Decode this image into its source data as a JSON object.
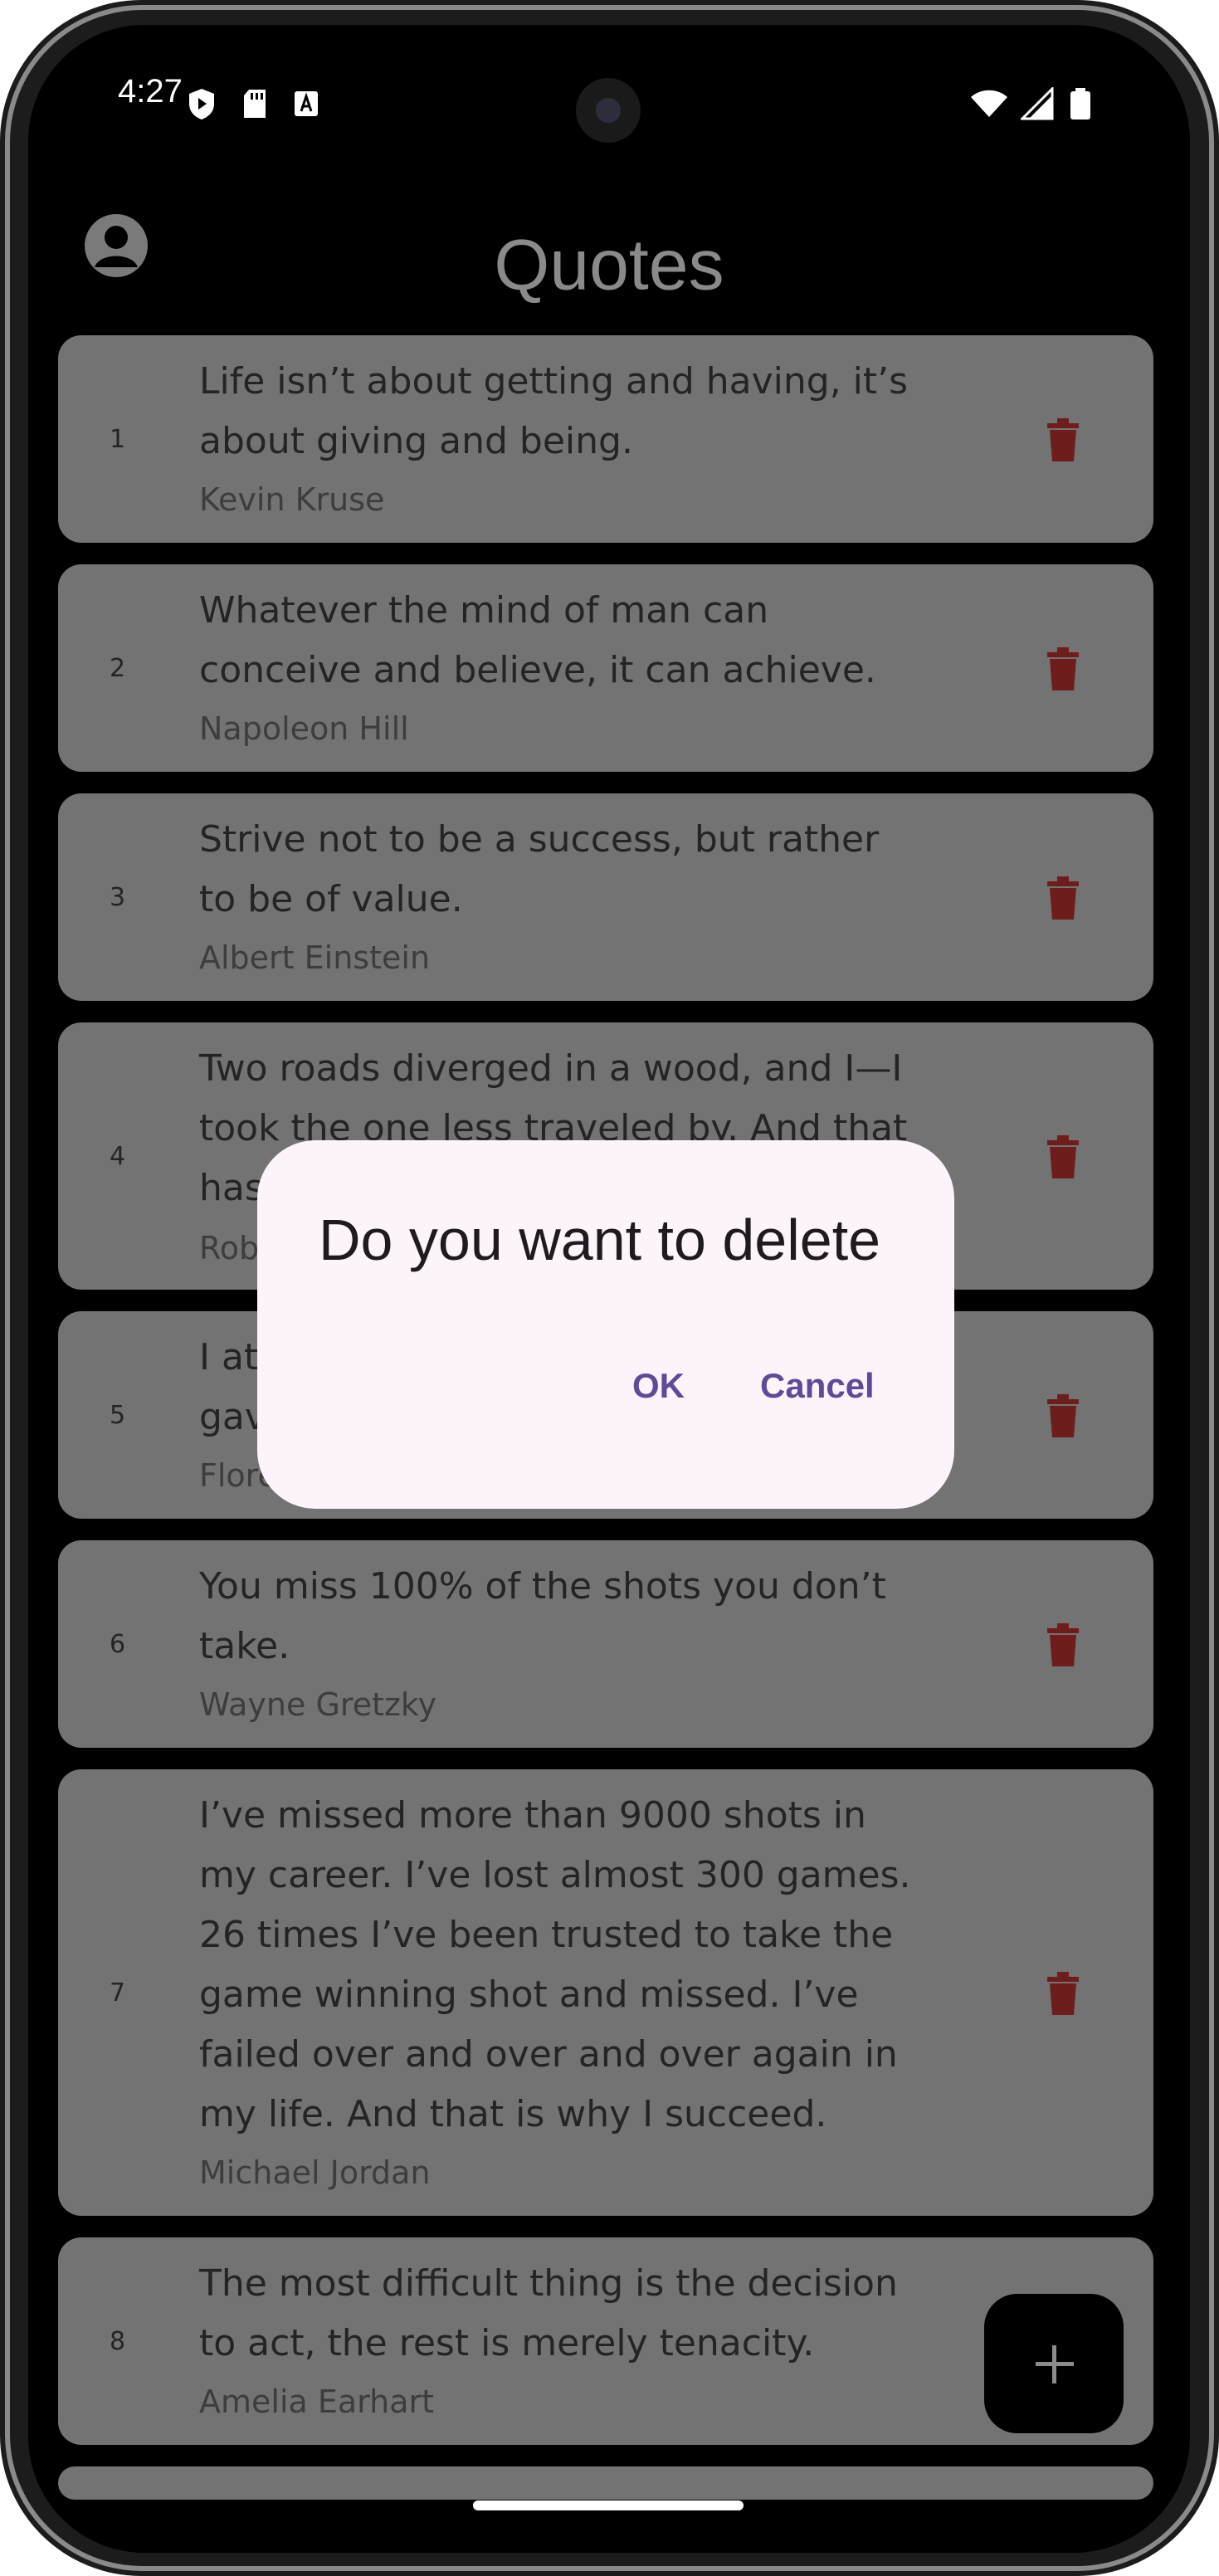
{
  "status_bar": {
    "time": "4:27"
  },
  "header": {
    "title": "Quotes"
  },
  "quotes": [
    {
      "num": "1",
      "lines": [
        "Life isn’t about getting and having, it’s",
        "about giving and being."
      ],
      "author": "Kevin Kruse"
    },
    {
      "num": "2",
      "lines": [
        "Whatever the mind of man can",
        "conceive and believe, it can achieve."
      ],
      "author": "Napoleon Hill"
    },
    {
      "num": "3",
      "lines": [
        "Strive not to be a success, but rather",
        "to be of value."
      ],
      "author": "Albert Einstein"
    },
    {
      "num": "4",
      "lines": [
        "Two roads diverged in a wood, and I—I",
        "took the one less traveled by. And that",
        "has"
      ],
      "author": "Rob"
    },
    {
      "num": "5",
      "lines": [
        "I at",
        "gav"
      ],
      "author": "Flore"
    },
    {
      "num": "6",
      "lines": [
        "You miss 100% of the shots you don’t",
        "take."
      ],
      "author": "Wayne Gretzky"
    },
    {
      "num": "7",
      "lines": [
        "I’ve missed more than 9000 shots in",
        "my career. I’ve lost almost 300 games.",
        "26 times I’ve been trusted to take the",
        "game winning shot and missed. I’ve",
        "failed over and over and over again in",
        "my life. And that is why I succeed."
      ],
      "author": "Michael Jordan"
    },
    {
      "num": "8",
      "lines": [
        "The most difficult thing is the decision",
        "to act, the rest is merely tenacity."
      ],
      "author": "Amelia Earhart"
    }
  ],
  "dialog": {
    "title": "Do you want to delete",
    "ok_label": "OK",
    "cancel_label": "Cancel"
  },
  "colors": {
    "trash_icon": "#6e1d1d",
    "dialog_button": "#5f4a9a",
    "dialog_bg": "#fdf4fb",
    "card_bg": "#737373"
  }
}
